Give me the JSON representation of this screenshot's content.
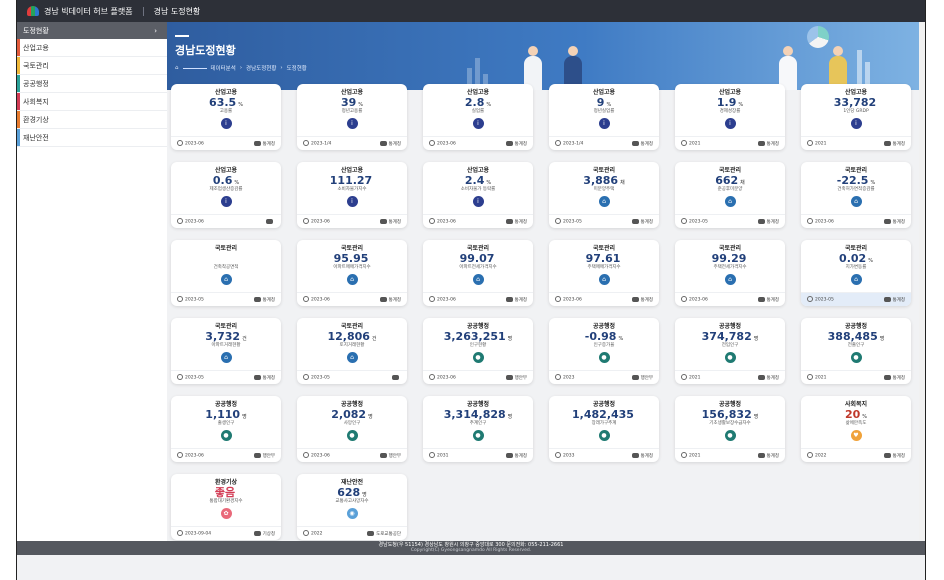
{
  "topbar": {
    "brand": "경남 빅데이터 허브 플랫폼",
    "section": "경남 도정현황"
  },
  "sidebar": {
    "header": "도정현황",
    "header_arrow": "›",
    "items": [
      {
        "label": "산업고용",
        "color": "#e25b3c"
      },
      {
        "label": "국토관리",
        "color": "#f0b93a"
      },
      {
        "label": "공공행정",
        "color": "#2aa198"
      },
      {
        "label": "사회복지",
        "color": "#d23b54"
      },
      {
        "label": "환경기상",
        "color": "#e77b2e"
      },
      {
        "label": "재난안전",
        "color": "#5aa0d8"
      }
    ]
  },
  "banner": {
    "title": "경남도정현황",
    "breadcrumb": [
      "데이터분석",
      "경남도정현황",
      "도정현황"
    ],
    "home_icon": "home-icon"
  },
  "cards": [
    {
      "cat": "산업고용",
      "value": "63.5",
      "unit": "%",
      "desc": "고용률",
      "icon": "i",
      "icon_color": "#2c3e8f",
      "date": "2023-06",
      "source": "통계청"
    },
    {
      "cat": "산업고용",
      "value": "39",
      "unit": "%",
      "desc": "청년고용률",
      "icon": "i",
      "icon_color": "#2c3e8f",
      "date": "2023-1/4",
      "source": "통계청"
    },
    {
      "cat": "산업고용",
      "value": "2.8",
      "unit": "%",
      "desc": "실업률",
      "icon": "i",
      "icon_color": "#2c3e8f",
      "date": "2023-06",
      "source": "통계청"
    },
    {
      "cat": "산업고용",
      "value": "9",
      "unit": "%",
      "desc": "청년실업률",
      "icon": "i",
      "icon_color": "#2c3e8f",
      "date": "2023-1/4",
      "source": "통계청"
    },
    {
      "cat": "산업고용",
      "value": "1.9",
      "unit": "%",
      "desc": "경제성장률",
      "icon": "i",
      "icon_color": "#2c3e8f",
      "date": "2021",
      "source": "통계청"
    },
    {
      "cat": "산업고용",
      "value": "33,782",
      "unit": "",
      "desc": "1인당 GRDP",
      "icon": "i",
      "icon_color": "#2c3e8f",
      "date": "2021",
      "source": "통계청"
    },
    {
      "cat": "산업고용",
      "value": "0.6",
      "unit": "%",
      "desc": "제조업생산증감률",
      "icon": "i",
      "icon_color": "#2c3e8f",
      "date": "2023-06",
      "source": ""
    },
    {
      "cat": "산업고용",
      "value": "111.27",
      "unit": "",
      "desc": "소비자물가지수",
      "icon": "i",
      "icon_color": "#2c3e8f",
      "date": "2023-06",
      "source": "통계청"
    },
    {
      "cat": "산업고용",
      "value": "2.4",
      "unit": "%",
      "desc": "소비자물가 등락률",
      "icon": "i",
      "icon_color": "#2c3e8f",
      "date": "2023-06",
      "source": "통계청"
    },
    {
      "cat": "국토관리",
      "value": "3,886",
      "unit": "채",
      "desc": "미분양주택",
      "icon": "⌂",
      "icon_color": "#2a6fb0",
      "date": "2023-05",
      "source": "통계청"
    },
    {
      "cat": "국토관리",
      "value": "662",
      "unit": "채",
      "desc": "준공후미분양",
      "icon": "⌂",
      "icon_color": "#2a6fb0",
      "date": "2023-05",
      "source": "통계청"
    },
    {
      "cat": "국토관리",
      "value": "-22.5",
      "unit": "%",
      "desc": "건축허가면적증감률",
      "icon": "⌂",
      "icon_color": "#2a6fb0",
      "date": "2023-06",
      "source": "통계청"
    },
    {
      "cat": "국토관리",
      "value": "",
      "unit": "",
      "desc": "건축착공면적",
      "icon": "⌂",
      "icon_color": "#2a6fb0",
      "date": "2023-05",
      "source": "통계청"
    },
    {
      "cat": "국토관리",
      "value": "95.95",
      "unit": "",
      "desc": "아파트매매가격지수",
      "icon": "⌂",
      "icon_color": "#2a6fb0",
      "date": "2023-06",
      "source": "통계청"
    },
    {
      "cat": "국토관리",
      "value": "99.07",
      "unit": "",
      "desc": "아파트전세가격지수",
      "icon": "⌂",
      "icon_color": "#2a6fb0",
      "date": "2023-06",
      "source": "통계청"
    },
    {
      "cat": "국토관리",
      "value": "97.61",
      "unit": "",
      "desc": "주택매매가격지수",
      "icon": "⌂",
      "icon_color": "#2a6fb0",
      "date": "2023-06",
      "source": "통계청"
    },
    {
      "cat": "국토관리",
      "value": "99.29",
      "unit": "",
      "desc": "주택전세가격지수",
      "icon": "⌂",
      "icon_color": "#2a6fb0",
      "date": "2023-06",
      "source": "통계청"
    },
    {
      "cat": "국토관리",
      "value": "0.02",
      "unit": "%",
      "desc": "지가변동률",
      "icon": "⌂",
      "icon_color": "#2a6fb0",
      "date": "2023-05",
      "source": "통계청",
      "highlight": true
    },
    {
      "cat": "국토관리",
      "value": "3,732",
      "unit": "건",
      "desc": "아파트거래현황",
      "icon": "⌂",
      "icon_color": "#2a6fb0",
      "date": "2023-05",
      "source": "통계청"
    },
    {
      "cat": "국토관리",
      "value": "12,806",
      "unit": "건",
      "desc": "토지거래현황",
      "icon": "⌂",
      "icon_color": "#2a6fb0",
      "date": "2023-05",
      "source": ""
    },
    {
      "cat": "공공행정",
      "value": "3,263,251",
      "unit": "명",
      "desc": "인구현황",
      "icon": "●",
      "icon_color": "#1f7a72",
      "date": "2023-06",
      "source": "행안부"
    },
    {
      "cat": "공공행정",
      "value": "-0.98",
      "unit": "%",
      "desc": "인구증가율",
      "icon": "●",
      "icon_color": "#1f7a72",
      "date": "2023",
      "source": "행안부"
    },
    {
      "cat": "공공행정",
      "value": "374,782",
      "unit": "명",
      "desc": "전입인구",
      "icon": "●",
      "icon_color": "#1f7a72",
      "date": "2021",
      "source": "통계청"
    },
    {
      "cat": "공공행정",
      "value": "388,485",
      "unit": "명",
      "desc": "전출인구",
      "icon": "●",
      "icon_color": "#1f7a72",
      "date": "2021",
      "source": "통계청"
    },
    {
      "cat": "공공행정",
      "value": "1,110",
      "unit": "명",
      "desc": "출생인구",
      "icon": "●",
      "icon_color": "#1f7a72",
      "date": "2023-06",
      "source": "행안부"
    },
    {
      "cat": "공공행정",
      "value": "2,082",
      "unit": "명",
      "desc": "사망인구",
      "icon": "●",
      "icon_color": "#1f7a72",
      "date": "2023-06",
      "source": "행안부"
    },
    {
      "cat": "공공행정",
      "value": "3,314,828",
      "unit": "명",
      "desc": "추계인구",
      "icon": "●",
      "icon_color": "#1f7a72",
      "date": "2031",
      "source": "통계청"
    },
    {
      "cat": "공공행정",
      "value": "1,482,435",
      "unit": "",
      "desc": "장래가구추계",
      "icon": "●",
      "icon_color": "#1f7a72",
      "date": "2033",
      "source": "통계청"
    },
    {
      "cat": "공공행정",
      "value": "156,832",
      "unit": "명",
      "desc": "기초생활보장수급자수",
      "icon": "●",
      "icon_color": "#1f7a72",
      "date": "2021",
      "source": "통계청"
    },
    {
      "cat": "사회복지",
      "value": "20",
      "unit": "%",
      "desc": "삶에만족도",
      "icon": "♥",
      "icon_color": "#f0a23a",
      "date": "2022",
      "source": "통계청",
      "value_color": "#c0392b"
    },
    {
      "cat": "환경기상",
      "value": "좋음",
      "unit": "",
      "desc": "통합대기환경지수",
      "icon": "✿",
      "icon_color": "#e9697a",
      "date": "2023-09-04",
      "source": "기상청",
      "value_color": "#d23b54"
    },
    {
      "cat": "재난안전",
      "value": "628",
      "unit": "명",
      "desc": "교통사고사망자수",
      "icon": "◉",
      "icon_color": "#5aa0d8",
      "date": "2022",
      "source": "도로교통공단"
    }
  ],
  "footer": {
    "address": "경남도청(우 51154) 경상남도 창원시 의창구 중앙대로 300 문의전화: 055-211-2661",
    "copyright": "Copyright(C) Gyeongsangnamdo All Rights Reserved."
  }
}
